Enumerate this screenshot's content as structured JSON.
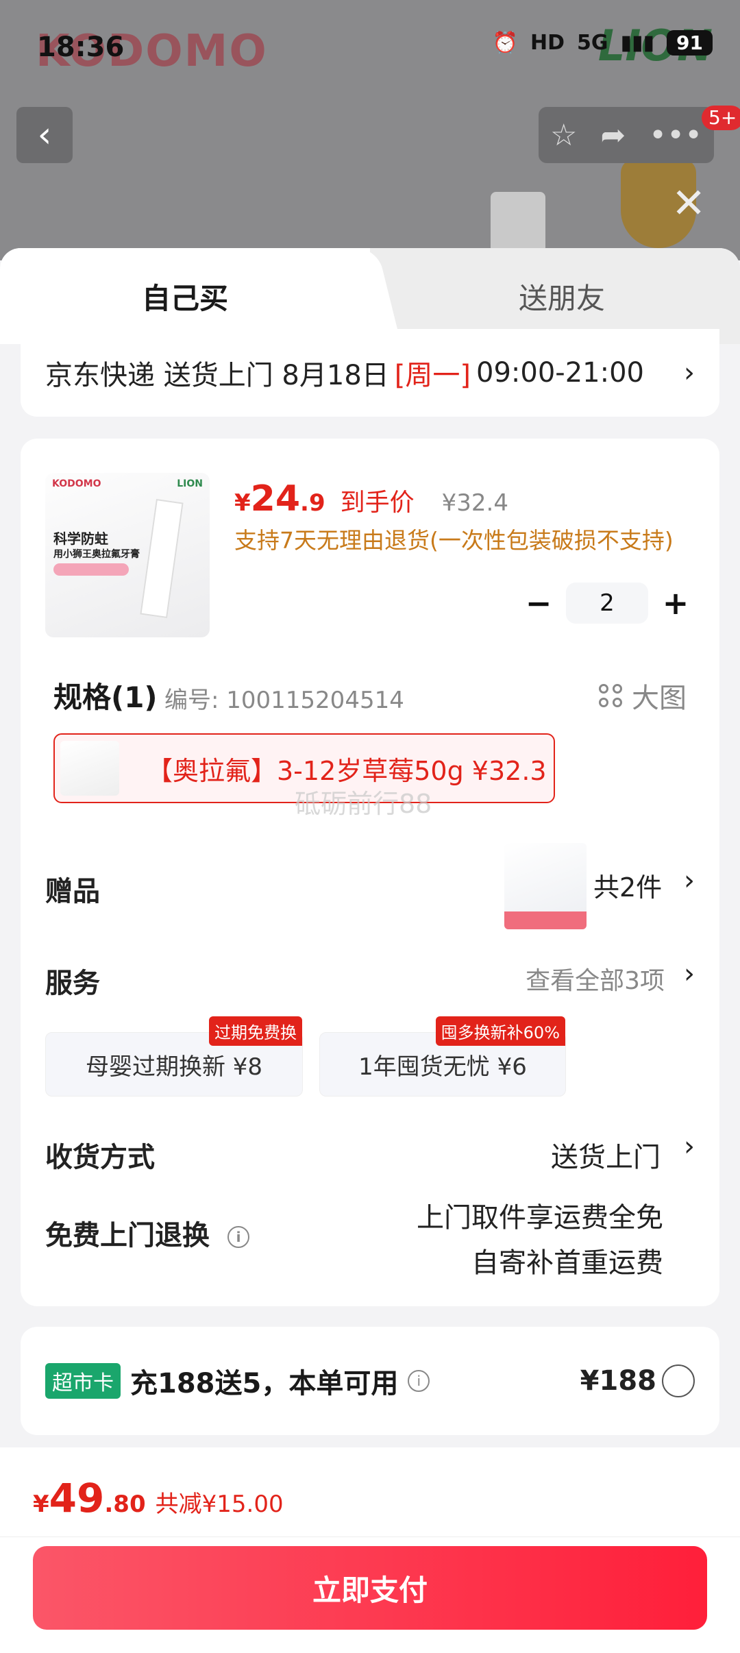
{
  "status_bar": {
    "time": "18:36",
    "network": "5G",
    "battery": "91",
    "hd_label": "HD"
  },
  "background": {
    "brand_logo": "KODOMO",
    "brand_lion": "LION",
    "notifications": "5+"
  },
  "tabs": [
    {
      "label": "自己买"
    },
    {
      "label": "送朋友"
    }
  ],
  "delivery": {
    "text": "京东快递 送货上门 8月18日",
    "weekday": "[周一]",
    "time_window": "09:00-21:00"
  },
  "product": {
    "price_symbol": "¥",
    "price_int": "24",
    "price_dec": ".9",
    "price_tag": "到手价",
    "original_price": "¥32.4",
    "return_note": "支持7天无理由退货(一次性包装破损不支持)",
    "image_title": "科学防蛀",
    "image_subtitle": "用小狮王奥拉氟牙膏",
    "quantity": "2"
  },
  "spec": {
    "title": "规格(1)",
    "code": "编号: 100115204514",
    "big_image": "大图",
    "option": "【奥拉氟】3-12岁草莓50g  ¥32.3",
    "watermark": "砥砺前行88"
  },
  "gift": {
    "label": "赠品",
    "count": "共2件"
  },
  "service": {
    "label": "服务",
    "view_all": "查看全部3项",
    "items": [
      {
        "name": "母婴过期换新  ¥8",
        "badge": "过期免费换"
      },
      {
        "name": "1年囤货无忧  ¥6",
        "badge": "囤多换新补60%"
      }
    ]
  },
  "shipping": {
    "label": "收货方式",
    "value": "送货上门"
  },
  "free_return": {
    "label": "免费上门退换",
    "line1": "上门取件享运费全免",
    "line2": "自寄补首重运费"
  },
  "promo": {
    "tag": "超市卡",
    "text": "充188送5，本单可用",
    "price": "¥188"
  },
  "footer": {
    "symbol": "¥",
    "total_int": "49",
    "total_dec": ".80",
    "savings": "共减¥15.00",
    "pay_button": "立即支付"
  },
  "colors": {
    "accent": "#e2231a",
    "pay_gradient_start": "#fb5668",
    "pay_gradient_end": "#ff1f3a",
    "promo_green": "#1aa66c"
  }
}
